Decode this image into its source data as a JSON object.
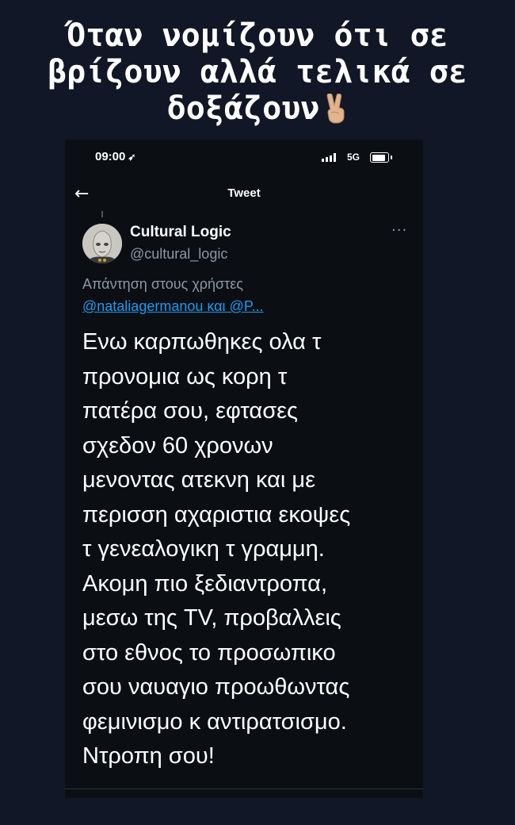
{
  "caption": {
    "lines": [
      "Όταν νομίζουν ότι σε",
      "βρίζουν αλλά τελικά σε",
      "δοξάζουν"
    ],
    "emoji": "victory-hand-emoji"
  },
  "statusbar": {
    "time": "09:00",
    "network": "5G"
  },
  "nav": {
    "title": "Tweet",
    "back_icon": "arrow-left-icon"
  },
  "tweet": {
    "author_name": "Cultural Logic",
    "author_handle": "@cultural_logic",
    "more_icon": "more-options-icon",
    "reply_label": "Απάντηση στους χρήστες",
    "reply_mentions": "@nataliagermanou και @P...",
    "text_lines": [
      "Ενω καρπωθηκες ολα τ",
      "προνομια ως κορη τ",
      "πατέρα σου, εφτασες",
      "σχεδον 60 χρονων",
      "μενοντας ατεκνη και με",
      "περισση αχαριστια εκοψες",
      "τ γενεαλογικη τ γραμμη.",
      "Ακομη πιο ξεδιαντροπα,",
      "μεσω της TV, προβαλλεις",
      "στο εθνος το προσωπικο",
      "σου ναυαγιο προωθωντας",
      "φεμινισμο κ αντιρατσισμο.",
      "Ντροπη σου!"
    ]
  },
  "colors": {
    "background": "#111726",
    "link": "#1d9bf0",
    "secondary_text": "#8b98a5"
  }
}
